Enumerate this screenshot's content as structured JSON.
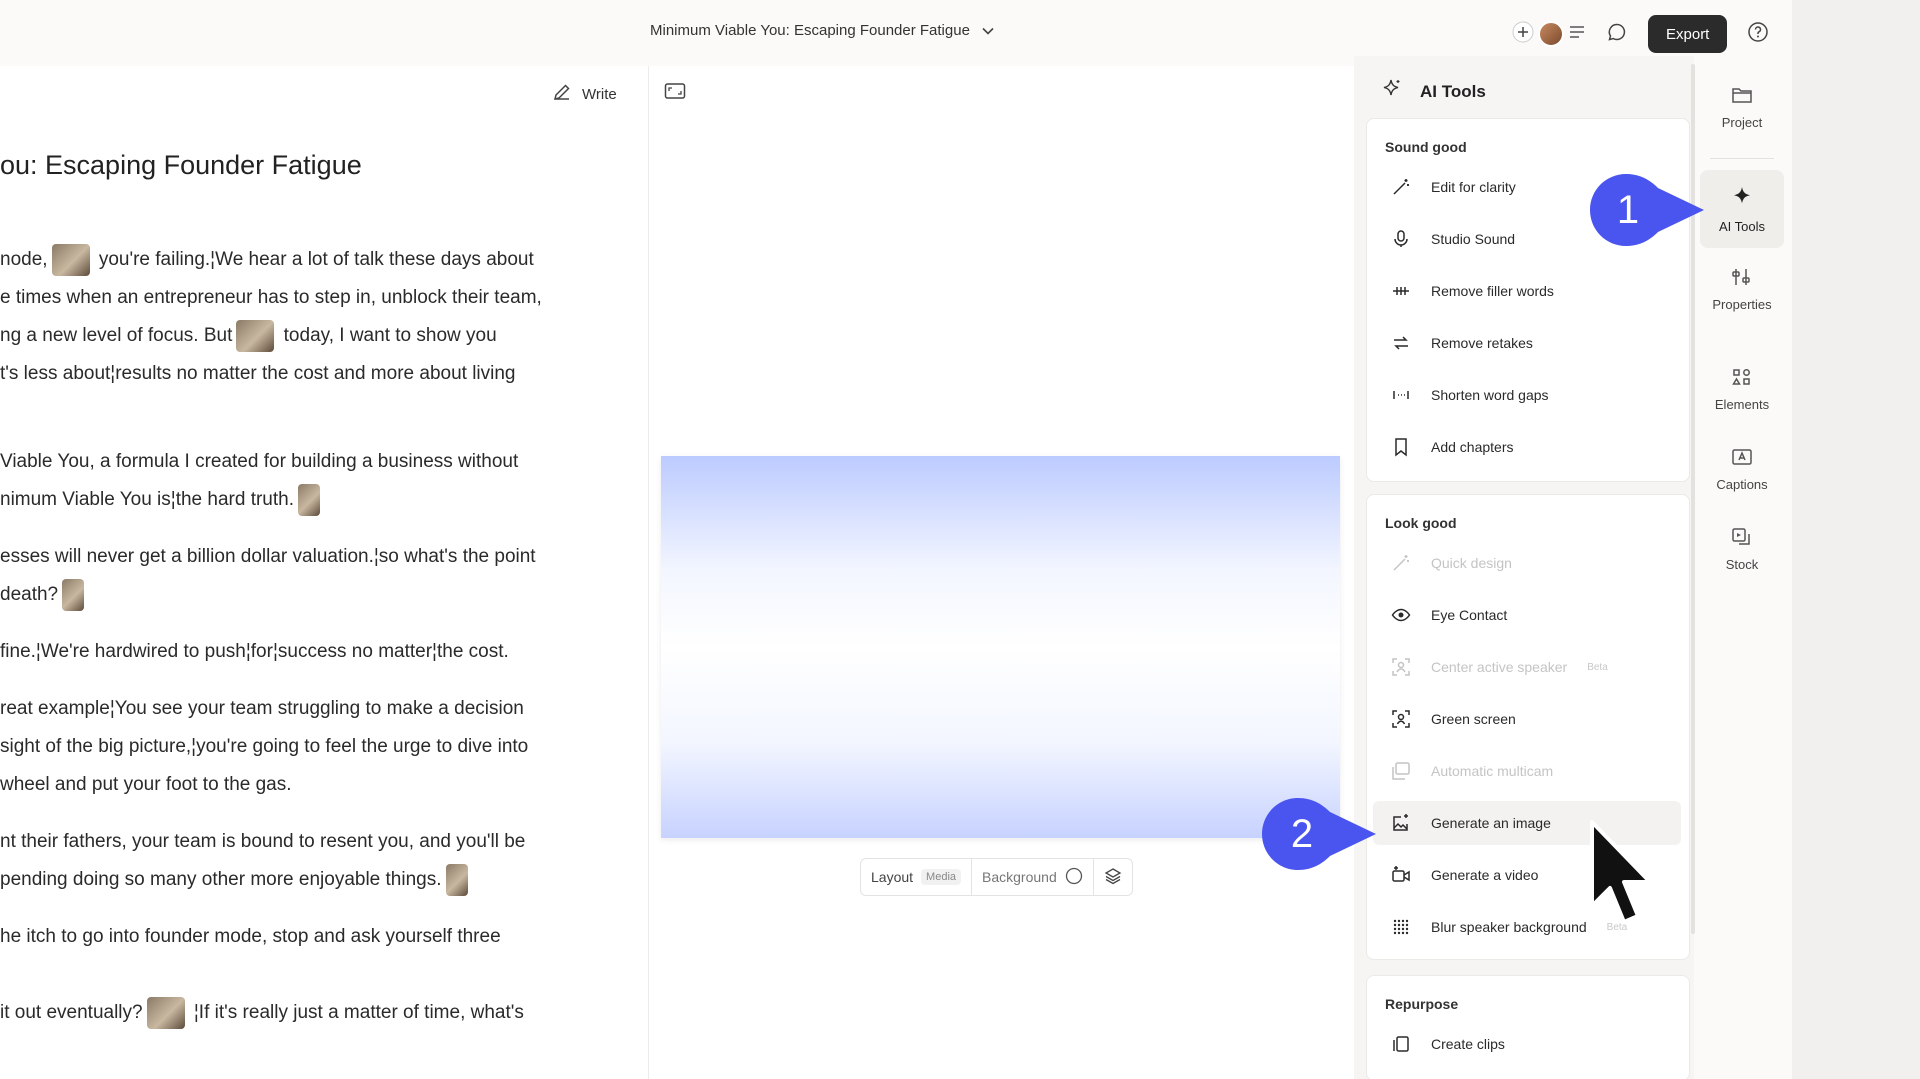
{
  "topbar": {
    "project_title": "Minimum Viable You: Escaping Founder Fatigue",
    "export_label": "Export"
  },
  "script": {
    "write_label": "Write",
    "title": "ou: Escaping Founder Fatigue",
    "lines": [
      [
        "node,",
        " you're failing.¦We hear a lot of talk these days about"
      ],
      [
        "e times when an entrepreneur has to step in, unblock their team,"
      ],
      [
        "ng a new level of focus. But",
        " today, I want to show you"
      ],
      [
        "t's less about¦results no matter the cost and more about living"
      ],
      [
        "Viable You, a formula I created for building a business without"
      ],
      [
        "nimum Viable You is¦the hard truth.",
        ""
      ],
      [
        "esses will never get a billion dollar valuation.¦so what's the point"
      ],
      [
        "death?",
        ""
      ],
      [
        "fine.¦We're hardwired to push¦for¦success no matter¦the cost."
      ],
      [
        "reat example¦You see your team struggling to make a decision"
      ],
      [
        "sight of the big picture,¦you're going to feel the urge to dive into"
      ],
      [
        "wheel and put your foot to the gas."
      ],
      [
        "nt their fathers, your team is bound to resent you, and you'll be"
      ],
      [
        "pending doing so many other more enjoyable things.",
        ""
      ],
      [
        "he itch to go into founder mode, stop and ask yourself three"
      ],
      [
        "it out eventually?",
        " ¦If it's really just a matter of time, what's"
      ]
    ]
  },
  "preview_toolbar": {
    "layout_label": "Layout",
    "layout_badge": "Media",
    "background_label": "Background"
  },
  "ai_tools": {
    "header": "AI Tools",
    "sections": [
      {
        "title": "Sound good",
        "items": [
          {
            "label": "Edit for clarity",
            "icon": "wand-icon"
          },
          {
            "label": "Studio Sound",
            "icon": "microphone-icon"
          },
          {
            "label": "Remove filler words",
            "icon": "filler-words-icon"
          },
          {
            "label": "Remove retakes",
            "icon": "retake-icon"
          },
          {
            "label": "Shorten word gaps",
            "icon": "word-gap-icon"
          },
          {
            "label": "Add chapters",
            "icon": "bookmark-icon"
          }
        ]
      },
      {
        "title": "Look good",
        "items": [
          {
            "label": "Quick design",
            "icon": "wand-icon",
            "disabled": true
          },
          {
            "label": "Eye Contact",
            "icon": "eye-icon"
          },
          {
            "label": "Center active speaker",
            "icon": "speaker-center-icon",
            "disabled": true,
            "badge": "Beta"
          },
          {
            "label": "Green screen",
            "icon": "green-screen-icon"
          },
          {
            "label": "Automatic multicam",
            "icon": "multicam-icon",
            "disabled": true
          },
          {
            "label": "Generate an image",
            "icon": "image-generate-icon",
            "hover": true
          },
          {
            "label": "Generate a video",
            "icon": "video-generate-icon"
          },
          {
            "label": "Blur speaker background",
            "icon": "blur-icon",
            "badge": "Beta"
          }
        ]
      },
      {
        "title": "Repurpose",
        "items": [
          {
            "label": "Create clips",
            "icon": "clips-icon"
          }
        ]
      }
    ]
  },
  "rail": [
    {
      "label": "Project",
      "icon": "folder-icon"
    },
    {
      "label": "AI Tools",
      "icon": "sparkle-icon",
      "active": true
    },
    {
      "label": "Properties",
      "icon": "sliders-icon"
    },
    {
      "label": "Elements",
      "icon": "shapes-icon"
    },
    {
      "label": "Captions",
      "icon": "captions-icon"
    },
    {
      "label": "Stock",
      "icon": "stock-media-icon"
    }
  ],
  "callouts": {
    "first": "1",
    "second": "2"
  },
  "colors": {
    "callout": "#4a55f0",
    "export_bg": "#2b2b2b",
    "preview_tint": "#bccbff"
  }
}
